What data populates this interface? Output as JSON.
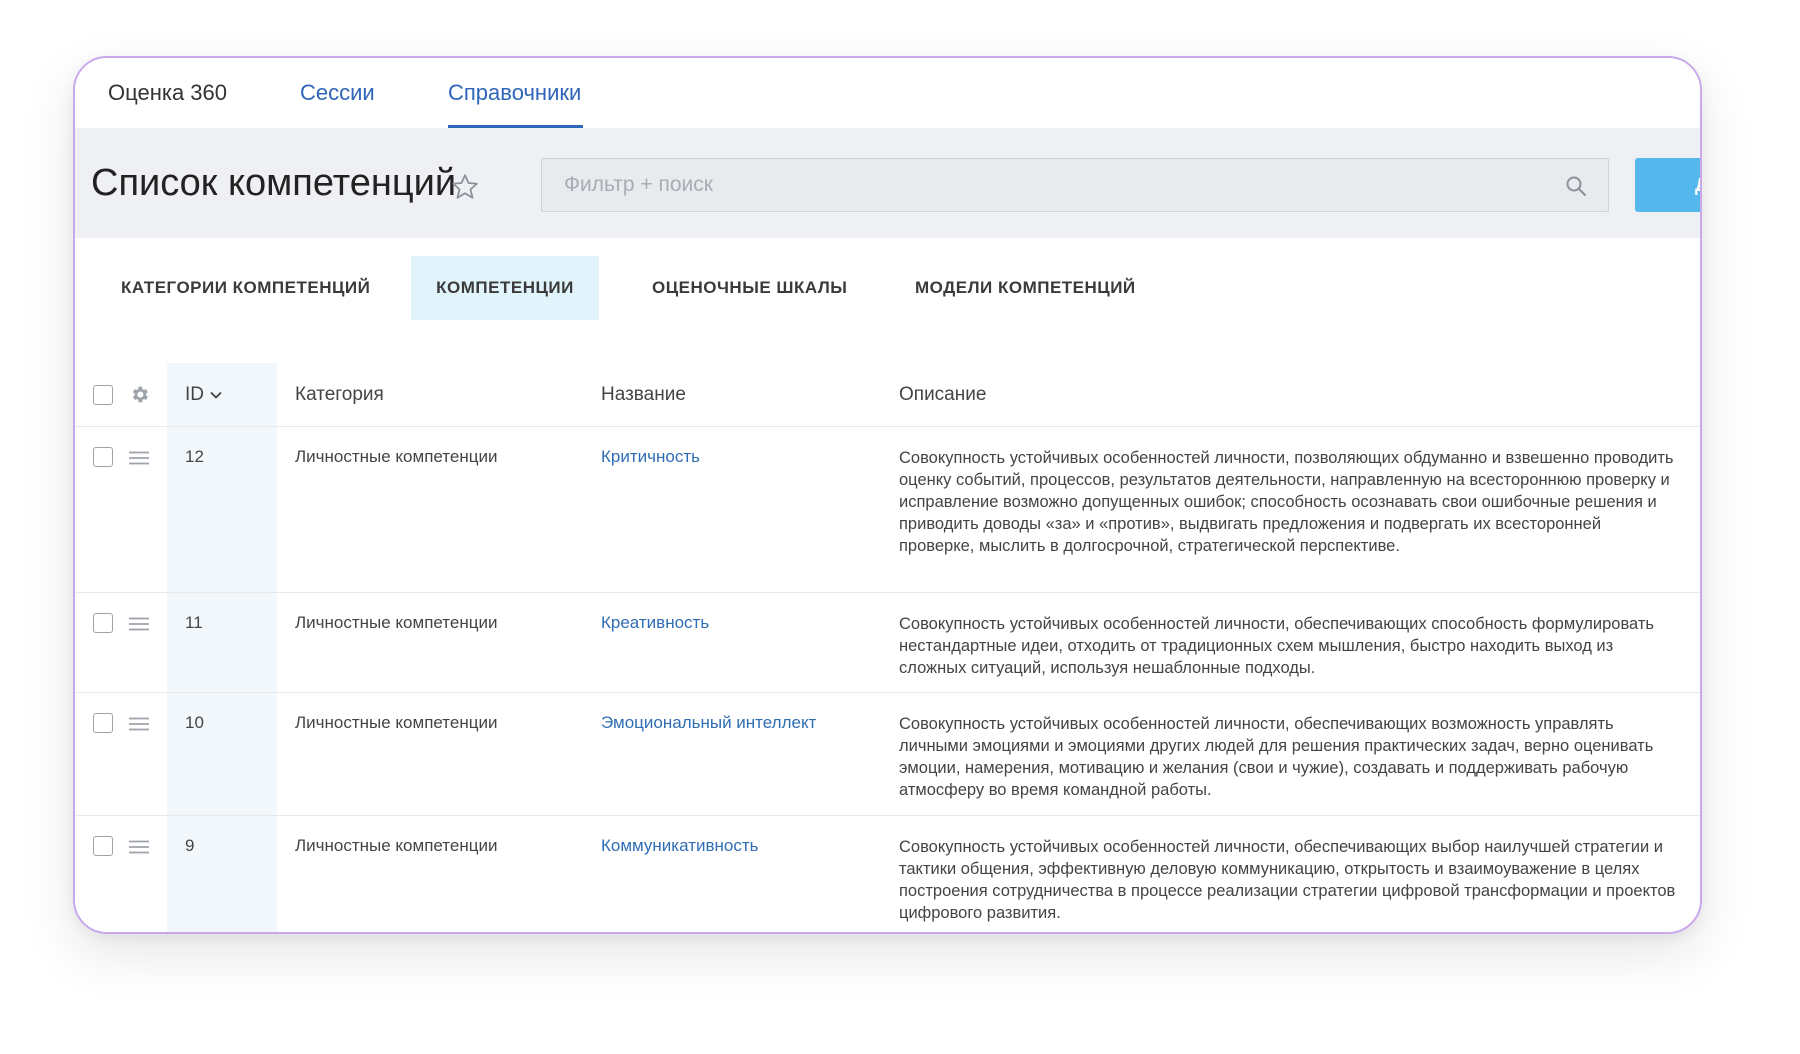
{
  "top_tabs": [
    "Оценка 360",
    "Сессии",
    "Справочники"
  ],
  "header": {
    "title": "Список компетенций",
    "search_placeholder": "Фильтр + поиск",
    "add_button_label": "Д"
  },
  "sub_tabs": [
    "КАТЕГОРИИ КОМПЕТЕНЦИЙ",
    "КОМПЕТЕНЦИИ",
    "ОЦЕНОЧНЫЕ ШКАЛЫ",
    "МОДЕЛИ КОМПЕТЕНЦИЙ"
  ],
  "table": {
    "columns": [
      "ID",
      "Категория",
      "Название",
      "Описание"
    ],
    "rows": [
      {
        "id": "12",
        "category": "Личностные компетенции",
        "name": "Критичность",
        "description": "Совокупность устойчивых особенностей личности, позволяющих обдуманно и взвешенно проводить оценку событий, процессов, результатов деятельности, направленную на всестороннюю проверку и исправление возможно допущенных ошибок; способность осознавать свои ошибочные решения и приводить доводы «за» и «против», выдвигать предложения и подвергать их всесторонней проверке, мыслить в долгосрочной, стратегической перспективе."
      },
      {
        "id": "11",
        "category": "Личностные компетенции",
        "name": "Креативность",
        "description": "Совокупность устойчивых особенностей личности, обеспечивающих способность формулировать нестандартные идеи, отходить от традиционных схем мышления, быстро находить выход из сложных ситуаций, используя нешаблонные подходы."
      },
      {
        "id": "10",
        "category": "Личностные компетенции",
        "name": "Эмоциональный интеллект",
        "description": "Совокупность устойчивых особенностей личности, обеспечивающих возможность управлять личными эмоциями и эмоциями других людей для решения практических задач, верно оценивать эмоции, намерения, мотивацию и желания (свои и чужие), создавать и поддерживать рабочую атмосферу во время командной работы."
      },
      {
        "id": "9",
        "category": "Личностные компетенции",
        "name": "Коммуникативность",
        "description": "Совокупность устойчивых особенностей личности, обеспечивающих выбор наилучшей стратегии и тактики общения, эффективную деловую коммуникацию, открытость и взаимоуважение в целях построения сотрудничества в процессе реализации стратегии цифровой трансформации и проектов цифрового развития."
      }
    ]
  },
  "colors": {
    "accent": "#2f65b8",
    "frame_border": "#c9a8ec",
    "add_button": "#55b8ec",
    "active_subtab_bg": "#e1f4fb",
    "link": "#2f6db5"
  }
}
